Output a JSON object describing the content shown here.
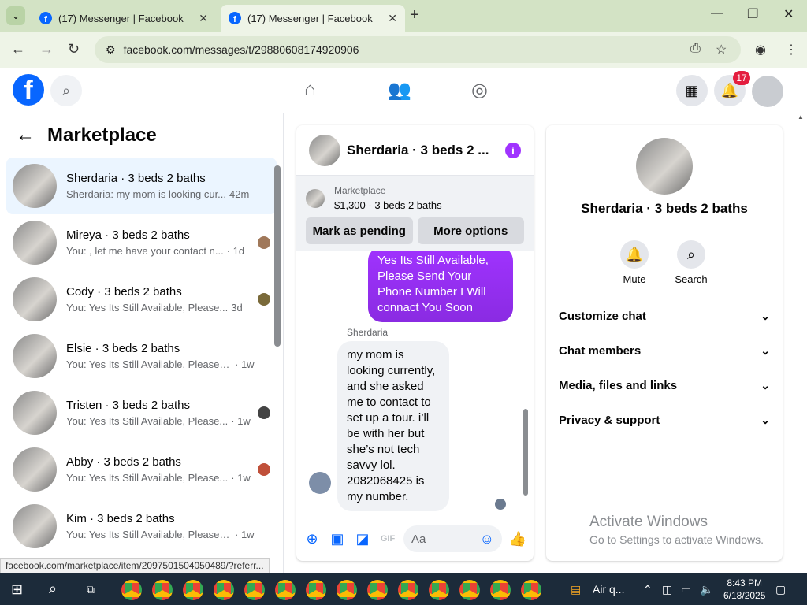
{
  "browser": {
    "tabs": [
      {
        "title": "(17) Messenger | Facebook"
      },
      {
        "title": "(17) Messenger | Facebook"
      }
    ],
    "url": "facebook.com/messages/t/29880608174920906"
  },
  "fb_header": {
    "notification_count": "17"
  },
  "left_panel": {
    "title": "Marketplace",
    "conversations": [
      {
        "name": "Sherdaria · 3 beds 2 baths",
        "preview": "Sherdaria: my mom is looking cur...",
        "time": "42m"
      },
      {
        "name": "Mireya · 3 beds 2 baths",
        "preview": "You: , let me have your contact n...",
        "time": "· 1d"
      },
      {
        "name": "Cody · 3 beds 2 baths",
        "preview": "You: Yes Its Still Available, Please...",
        "time": "3d"
      },
      {
        "name": "Elsie · 3 beds 2 baths",
        "preview": "You: Yes Its Still Available, Please Se...",
        "time": "· 1w"
      },
      {
        "name": "Tristen · 3 beds 2 baths",
        "preview": "You: Yes Its Still Available, Please...",
        "time": "· 1w"
      },
      {
        "name": "Abby · 3 beds 2 baths",
        "preview": "You: Yes Its Still Available, Please...",
        "time": "· 1w"
      },
      {
        "name": "Kim · 3 beds 2 baths",
        "preview": "You: Yes Its Still Available, Please Se...",
        "time": "· 1w"
      }
    ]
  },
  "chat": {
    "title": "Sherdaria · 3 beds 2 ...",
    "marketplace_label": "Marketplace",
    "listing": "$1,300 - 3 beds 2 baths",
    "btn_pending": "Mark as pending",
    "btn_more": "More options",
    "outgoing_message": "Yes Its Still Available, Please Send Your Phone Number I Will connact You Soon",
    "sender_name": "Sherdaria",
    "incoming_message": "my mom is looking currently, and she asked me to contact to set up a tour. i’ll be with her but she’s not tech savvy lol. 2082068425 is my number.",
    "input_placeholder": "Aa"
  },
  "details": {
    "name": "Sherdaria · 3 beds 2 baths",
    "mute_label": "Mute",
    "search_label": "Search",
    "sections": [
      "Customize chat",
      "Chat members",
      "Media, files and links",
      "Privacy & support"
    ]
  },
  "watermark": {
    "line1": "Activate Windows",
    "line2": "Go to Settings to activate Windows."
  },
  "status_url": "facebook.com/marketplace/item/2097501504050489/?referr...",
  "taskbar": {
    "tray_label": "Air q...",
    "time": "8:43 PM",
    "date": "6/18/2025"
  }
}
